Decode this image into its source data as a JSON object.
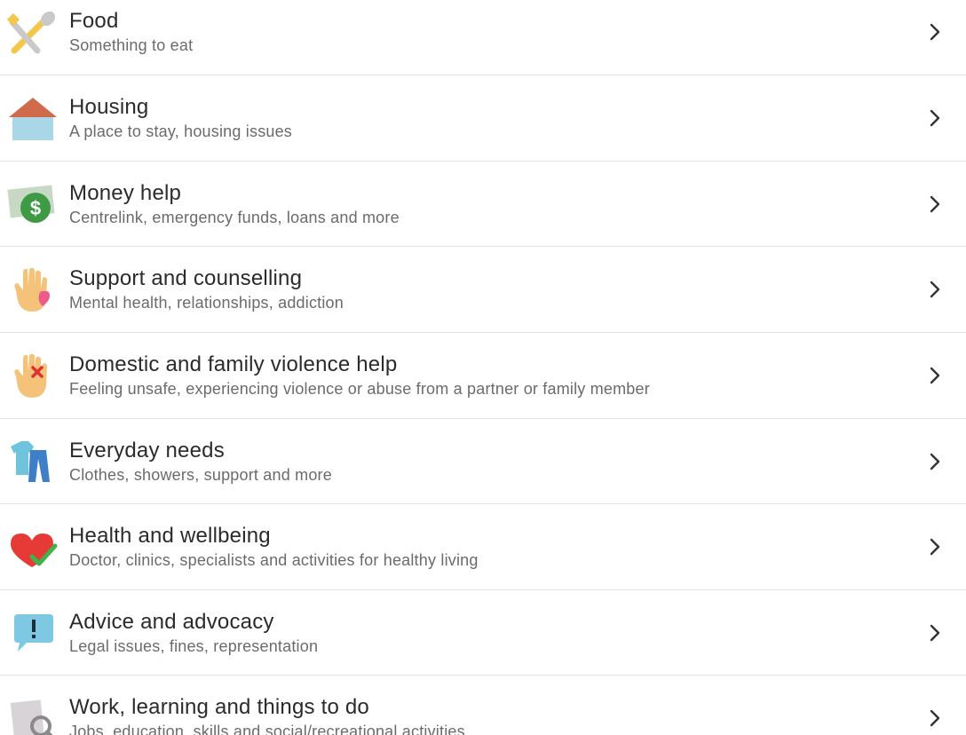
{
  "categories": [
    {
      "title": "Food",
      "subtitle": "Something to eat",
      "icon": "fork-spoon-icon"
    },
    {
      "title": "Housing",
      "subtitle": "A place to stay, housing issues",
      "icon": "house-icon"
    },
    {
      "title": "Money help",
      "subtitle": "Centrelink, emergency funds, loans and more",
      "icon": "money-icon"
    },
    {
      "title": "Support and counselling",
      "subtitle": "Mental health, relationships, addiction",
      "icon": "hand-heart-icon"
    },
    {
      "title": "Domestic and family violence help",
      "subtitle": "Feeling unsafe, experiencing violence or abuse from a partner or family member",
      "icon": "hand-stop-icon"
    },
    {
      "title": "Everyday needs",
      "subtitle": "Clothes, showers, support and more",
      "icon": "clothes-icon"
    },
    {
      "title": "Health and wellbeing",
      "subtitle": "Doctor, clinics, specialists and activities for healthy living",
      "icon": "heart-check-icon"
    },
    {
      "title": "Advice and advocacy",
      "subtitle": "Legal issues, fines, representation",
      "icon": "speech-bubble-icon"
    },
    {
      "title": "Work, learning and things to do",
      "subtitle": "Jobs, education, skills and social/recreational activities",
      "icon": "magnifier-icon"
    }
  ]
}
